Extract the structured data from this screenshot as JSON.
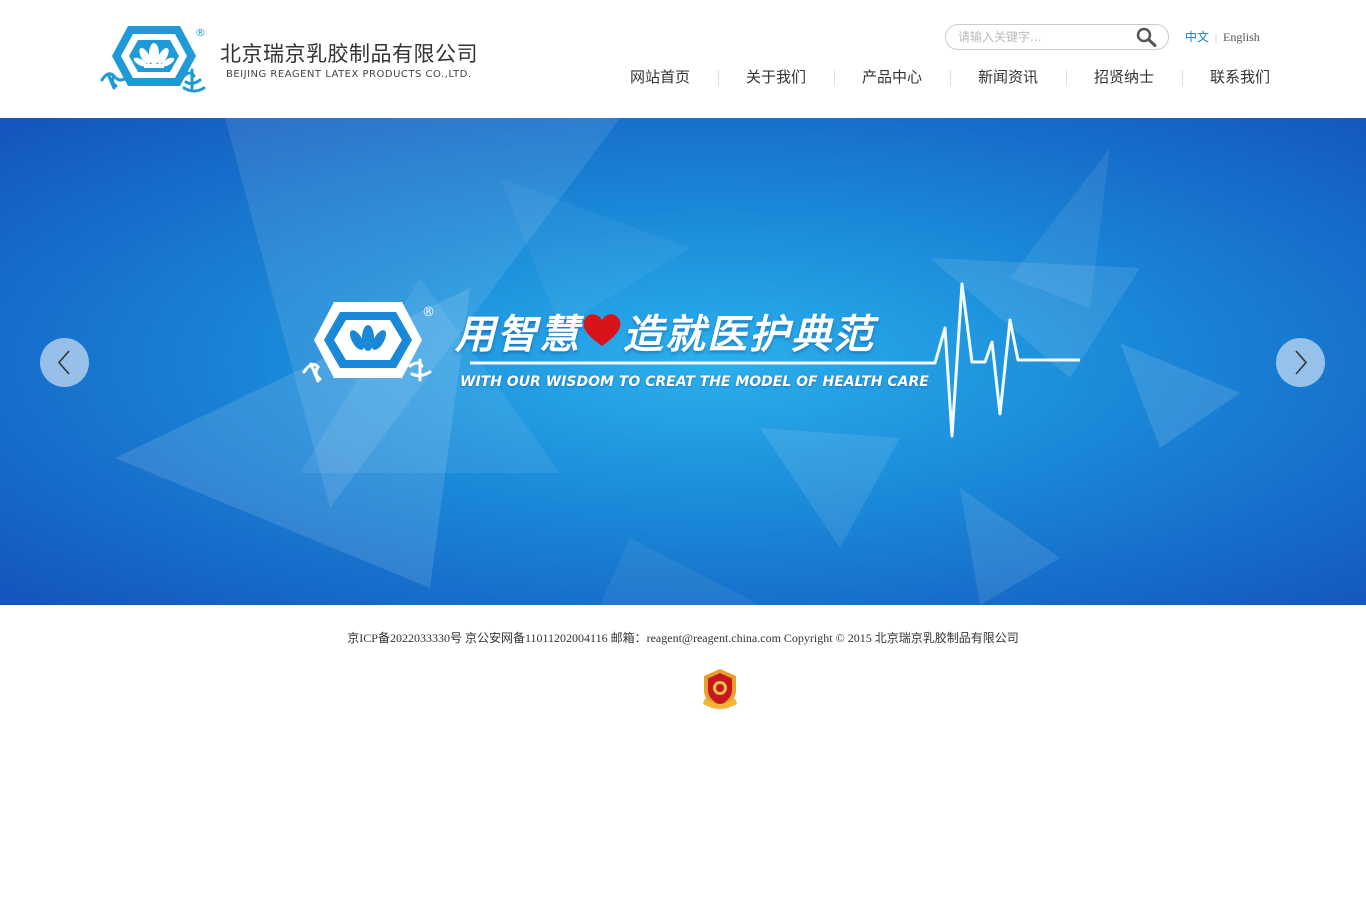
{
  "header": {
    "company_name_cn": "北京瑞京乳胶制品有限公司",
    "company_name_en": "BEIJING REAGENT LATEX PRODUCTS CO.,LTD.",
    "logo_icon": "snow-lotus-hexagon-logo-icon",
    "search": {
      "placeholder": "请输入关键字...",
      "icon": "search-icon"
    },
    "languages": [
      {
        "label": "中文",
        "active": true
      },
      {
        "label": "English",
        "active": false
      }
    ],
    "nav": [
      {
        "label": "网站首页"
      },
      {
        "label": "关于我们"
      },
      {
        "label": "产品中心"
      },
      {
        "label": "新闻资讯"
      },
      {
        "label": "招贤纳士"
      },
      {
        "label": "联系我们"
      }
    ]
  },
  "banner": {
    "slogan_cn_part1": "用智慧",
    "slogan_cn_part2": "造就医护典范",
    "slogan_en": "WITH OUR WISDOM TO CREAT THE MODEL OF HEALTH CARE",
    "prev_icon": "chevron-left-icon",
    "next_icon": "chevron-right-icon",
    "colors": {
      "primary": "#1763c4",
      "accent": "#29a9e8",
      "heart": "#d9131b"
    }
  },
  "footer": {
    "copyright_line": "京ICP备2022033330号 京公安网备11011202004116 邮箱：reagent@reagent.china.com Copyright © 2015 北京瑞京乳胶制品有限公司",
    "badge_icon": "police-security-badge-icon"
  },
  "colors": {
    "link_active": "#1a7fc8",
    "logo_blue": "#1f9ad6"
  }
}
